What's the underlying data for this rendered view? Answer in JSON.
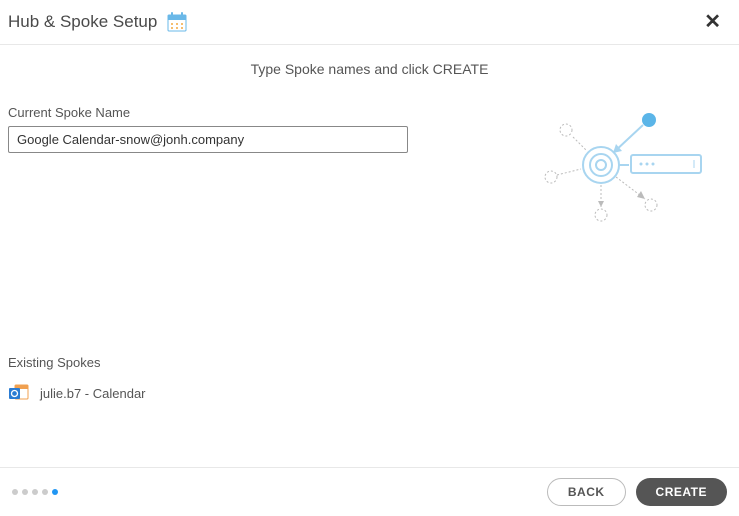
{
  "header": {
    "title": "Hub & Spoke Setup"
  },
  "instruction": "Type Spoke names and click CREATE",
  "form": {
    "current_label": "Current Spoke Name",
    "current_value": "Google Calendar-snow@jonh.company"
  },
  "existing": {
    "label": "Existing Spokes",
    "items": [
      {
        "name": "julie.b7 - Calendar"
      }
    ]
  },
  "footer": {
    "back_label": "BACK",
    "create_label": "CREATE",
    "total_steps": 5,
    "active_step": 4
  },
  "colors": {
    "accent": "#2196f3",
    "illustration": "#a8d5f0"
  }
}
